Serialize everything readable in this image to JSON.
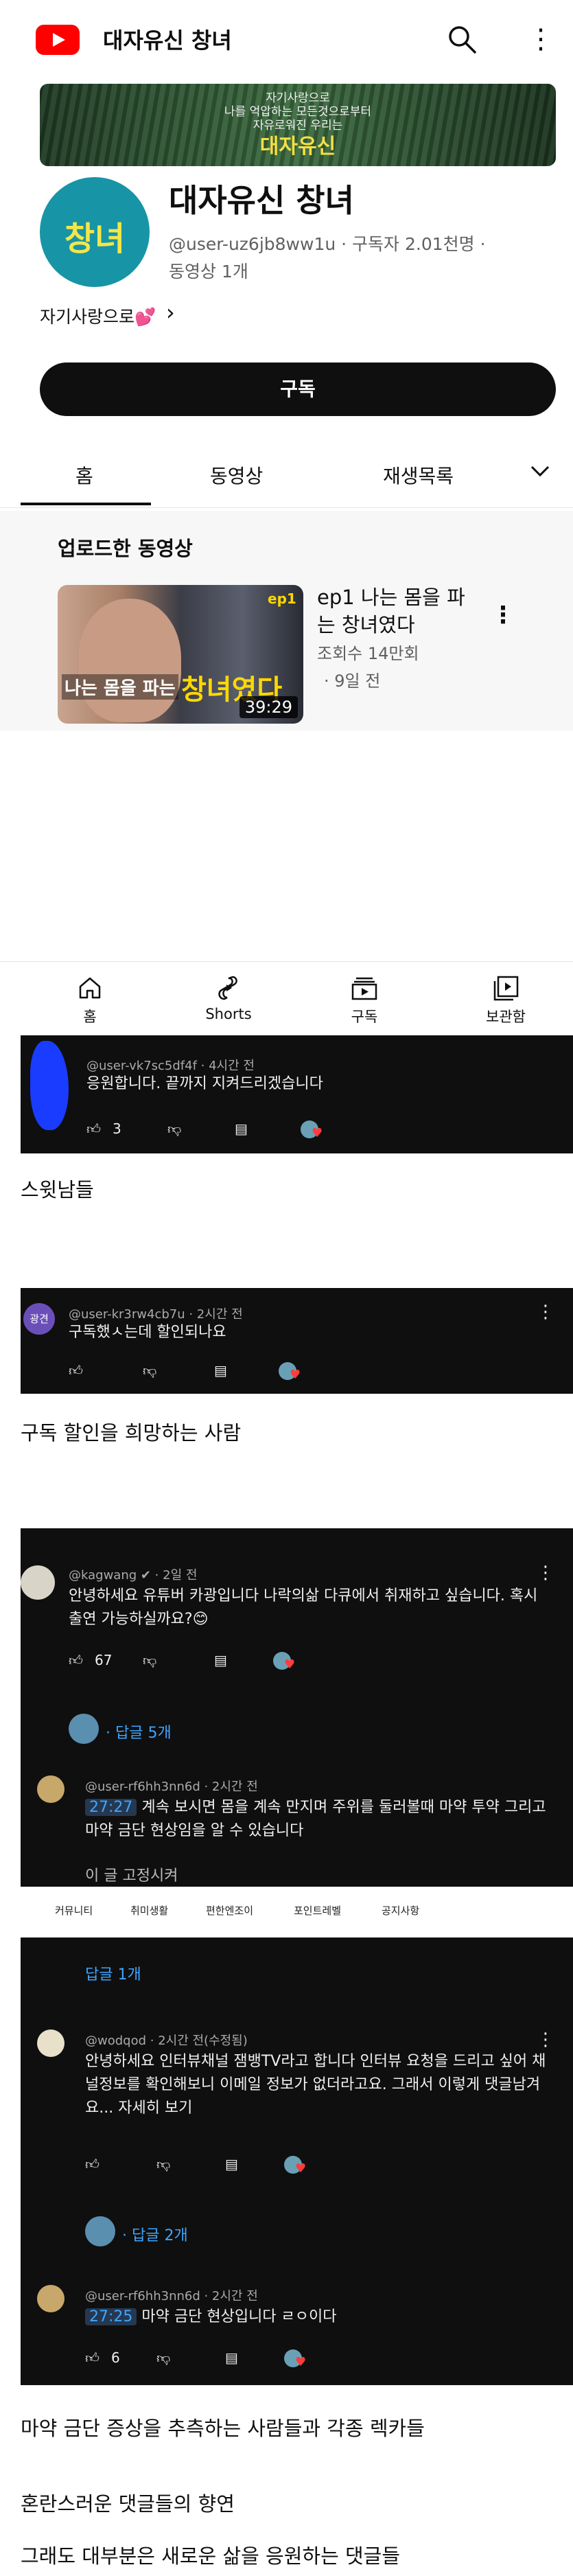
{
  "header": {
    "title": "대자유신 창녀"
  },
  "banner": {
    "lines": [
      "자기사랑으로",
      "나를 억압하는 모든것으로부터",
      "자유로워진 우리는"
    ],
    "name": "대자유신"
  },
  "channel": {
    "avatar_text": "창녀",
    "name": "대자유신 창녀",
    "meta1": "@user-uz6jb8ww1u · 구독자 2.01천명 ·",
    "meta2": "동영상 1개",
    "description": "자기사랑으로💕",
    "subscribe_label": "구독"
  },
  "tabs": [
    "홈",
    "동영상",
    "재생목록"
  ],
  "section": {
    "title": "업로드한 동영상",
    "video": {
      "thumb_text1": "나는 몸을 파는",
      "thumb_text2": "창녀였다",
      "thumb_ep": "ep1",
      "duration": "39:29",
      "title": "ep1 나는 몸을 파는 창녀였다",
      "views": "조회수 14만회",
      "date": "· 9일 전"
    }
  },
  "bottom_nav": [
    "홈",
    "Shorts",
    "구독",
    "보관함"
  ],
  "comment1": {
    "handle": "@user-vk7sc5df4f · 4시간 전",
    "text": "응원합니다. 끝까지 지켜드리겠습니다",
    "likes": "3"
  },
  "caption1": "스윗남들",
  "comment2": {
    "avatar_text": "광견",
    "handle": "@user-kr3rw4cb7u · 2시간 전",
    "text": "구독했ㅅ는데 할인되나요"
  },
  "caption2": "구독 할인을 희망하는 사람",
  "comment3": {
    "handle": "@kagwang ✔ · 2일 전",
    "text": "안녕하세요 유튜버 카광입니다 나락의삶 다큐에서 취재하고 싶습니다. 혹시 출연 가능하실까요?😊",
    "likes": "67",
    "replies": "· 답글 5개",
    "reply_handle": "@user-rf6hh3nn6d · 2시간 전",
    "reply_ts": "27:27",
    "reply_text": "계속 보시면 몸을 계속 만지며 주위를 둘러볼때 마약 투약 그리고 마약 금단 현상임을 알 수 있습니다",
    "reply_cut": "이 글 고정시켜"
  },
  "menu_strip": [
    "커뮤니티",
    "취미생활",
    "편한엔조이",
    "포인트레벨",
    "공지사항"
  ],
  "comment4": {
    "replies_top": "답글 1개",
    "handle": "@wodqod · 2시간 전(수정됨)",
    "text": "안녕하세요 인터뷰채널 잼뱅TV라고 합니다 인터뷰 요청을 드리고 싶어 채널정보를 확인해보니 이메일 정보가 없더라고요. 그래서 이렇게 댓글남겨요... 자세히 보기",
    "replies": "· 답글 2개",
    "reply_handle": "@user-rf6hh3nn6d · 2시간 전",
    "reply_ts": "27:25",
    "reply_text": "마약 금단 현상입니다 ㄹㅇ이다",
    "reply_likes": "6"
  },
  "caption3": "마약 금단 증상을 추측하는 사람들과 각종 렉카들",
  "caption4": "혼란스러운 댓글들의 향연",
  "caption5": "그래도 대부분은 새로운 삶을 응원하는 댓글들"
}
